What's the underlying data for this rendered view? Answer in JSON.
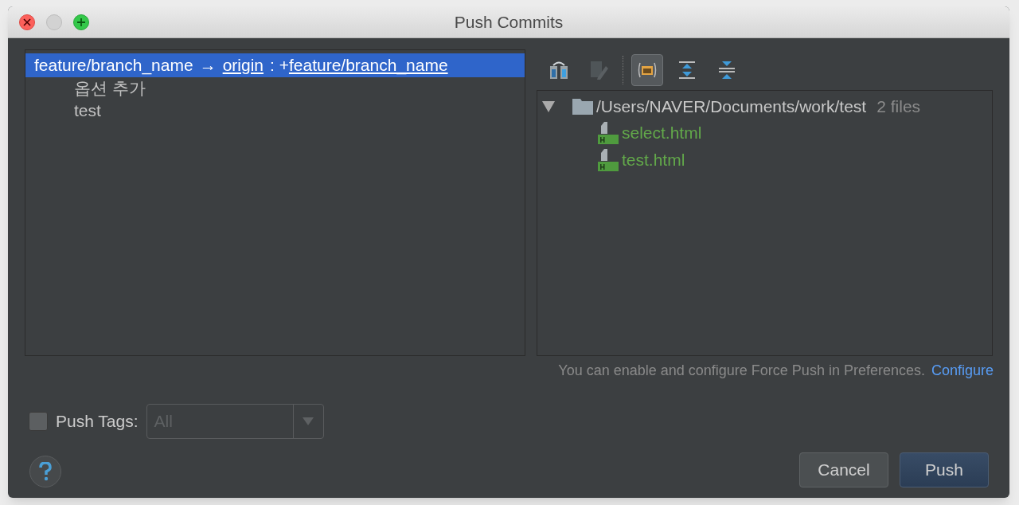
{
  "window": {
    "title": "Push Commits"
  },
  "push_spec": {
    "selected": true,
    "source": "feature/branch_name",
    "arrow": "→",
    "remote": "origin",
    "separator": ": +",
    "target": "feature/branch_name",
    "commits": [
      "옵션 추가",
      "test"
    ]
  },
  "toolbar": [
    {
      "kind": "diff",
      "selected": false,
      "disabled": false
    },
    {
      "kind": "edit",
      "selected": false,
      "disabled": true
    },
    {
      "kind": "group",
      "selected": true,
      "disabled": false
    },
    {
      "kind": "expand",
      "selected": false,
      "disabled": false
    },
    {
      "kind": "collapse",
      "selected": false,
      "disabled": false
    }
  ],
  "tree": {
    "path": "/Users/NAVER/Documents/work/test",
    "count": "2 files",
    "expanded": true,
    "files": [
      "select.html",
      "test.html"
    ]
  },
  "notice": {
    "text": "You can enable and configure Force Push in Preferences.",
    "link": "Configure"
  },
  "push_tags": {
    "label": "Push Tags:",
    "checked": false,
    "value": "All",
    "disabled": true
  },
  "buttons": [
    {
      "label": "Cancel",
      "kind": "secondary"
    },
    {
      "label": "Push",
      "kind": "primary"
    }
  ]
}
